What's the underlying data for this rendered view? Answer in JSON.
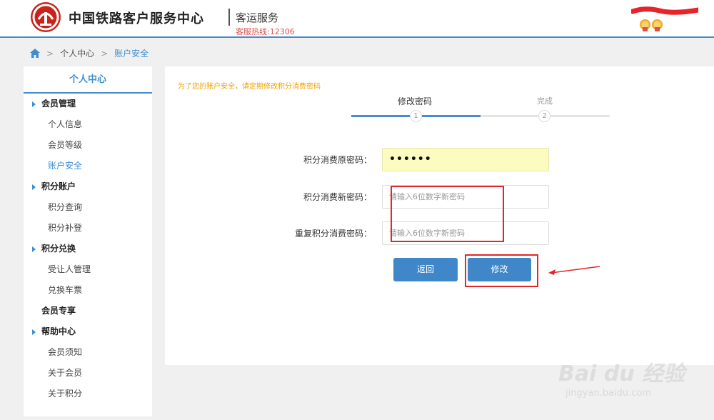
{
  "header": {
    "brand": "中国铁路客户服务中心",
    "subtitle": "客运服务",
    "hotline": "客服热线:12306"
  },
  "breadcrumb": {
    "items": [
      "个人中心",
      "账户安全"
    ]
  },
  "sidebar": {
    "title": "个人中心",
    "groups": [
      {
        "label": "会员管理",
        "items": [
          "个人信息",
          "会员等级",
          "账户安全"
        ]
      },
      {
        "label": "积分账户",
        "items": [
          "积分查询",
          "积分补登"
        ]
      },
      {
        "label": "积分兑换",
        "items": [
          "受让人管理",
          "兑换车票"
        ]
      },
      {
        "label": "会员专享",
        "items": []
      },
      {
        "label": "帮助中心",
        "items": [
          "会员须知",
          "关于会员",
          "关于积分"
        ]
      }
    ]
  },
  "main": {
    "tip": "为了您的账户安全，请定期修改积分消费密码",
    "steps": [
      {
        "label": "修改密码",
        "num": "1"
      },
      {
        "label": "完成",
        "num": "2"
      }
    ],
    "form": {
      "old_label": "积分消费原密码：",
      "old_value": "••••••",
      "new_label": "积分消费新密码：",
      "new_placeholder": "请输入6位数字新密码",
      "confirm_label": "重复积分消费密码：",
      "confirm_placeholder": "请输入6位数字新密码"
    },
    "buttons": {
      "back": "返回",
      "submit": "修改"
    }
  },
  "watermark": {
    "text": "Bai du 经验",
    "url": "jingyan.baidu.com"
  },
  "colors": {
    "accent": "#3f87c8",
    "highlight": "#e4262a",
    "tip": "#f0a000",
    "logo": "#c8241c"
  }
}
